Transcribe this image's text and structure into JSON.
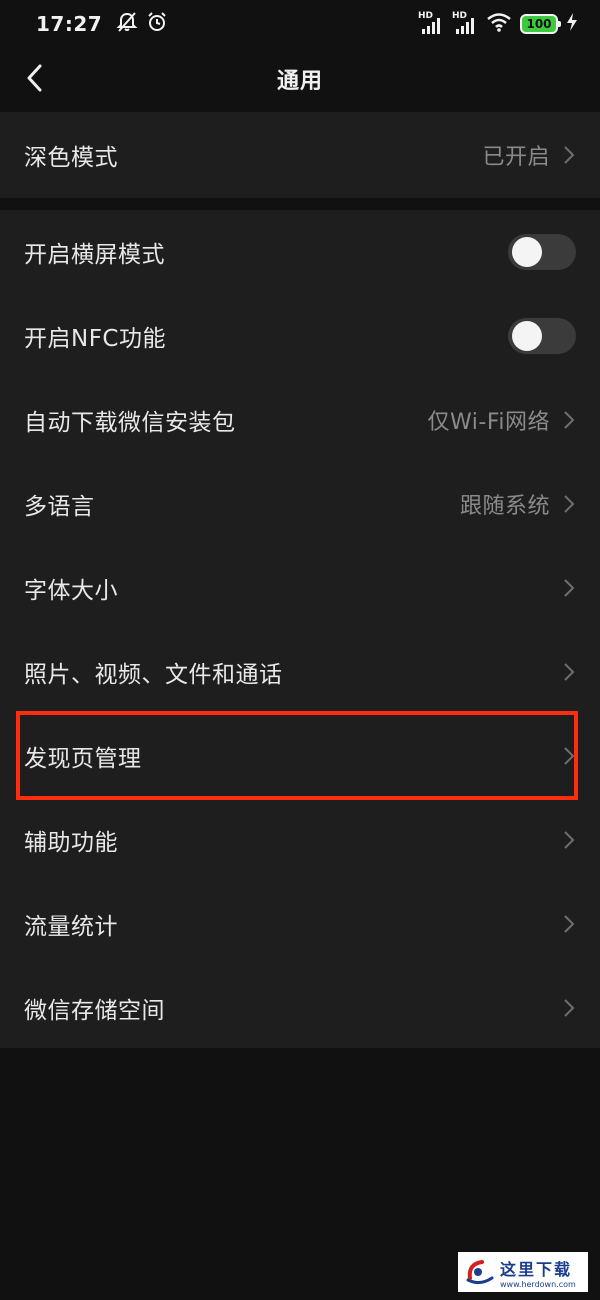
{
  "status_bar": {
    "time": "17:27",
    "signal_1_label": "HD",
    "signal_2_label": "HD",
    "battery": "100",
    "icons": [
      "notifications-off-icon",
      "alarm-icon",
      "signal-icon",
      "wifi-icon",
      "battery-icon",
      "charging-icon"
    ]
  },
  "header": {
    "title": "通用",
    "back_icon": "chevron-left-icon"
  },
  "section_1": {
    "rows": [
      {
        "label": "深色模式",
        "value": "已开启"
      }
    ]
  },
  "section_2": {
    "rows": [
      {
        "label": "开启横屏模式",
        "type": "toggle",
        "on": false
      },
      {
        "label": "开启NFC功能",
        "type": "toggle",
        "on": false
      },
      {
        "label": "自动下载微信安装包",
        "value": "仅Wi-Fi网络"
      },
      {
        "label": "多语言",
        "value": "跟随系统"
      },
      {
        "label": "字体大小"
      },
      {
        "label": "照片、视频、文件和通话"
      },
      {
        "label": "发现页管理",
        "highlighted": true
      },
      {
        "label": "辅助功能"
      },
      {
        "label": "流量统计"
      },
      {
        "label": "微信存储空间"
      }
    ]
  },
  "colors": {
    "background": "#111111",
    "section": "#1e1e1e",
    "highlight": "#ff2d10",
    "battery": "#3fc93f"
  },
  "watermark": {
    "text": "这里下载",
    "url": "www.herdown.com"
  }
}
